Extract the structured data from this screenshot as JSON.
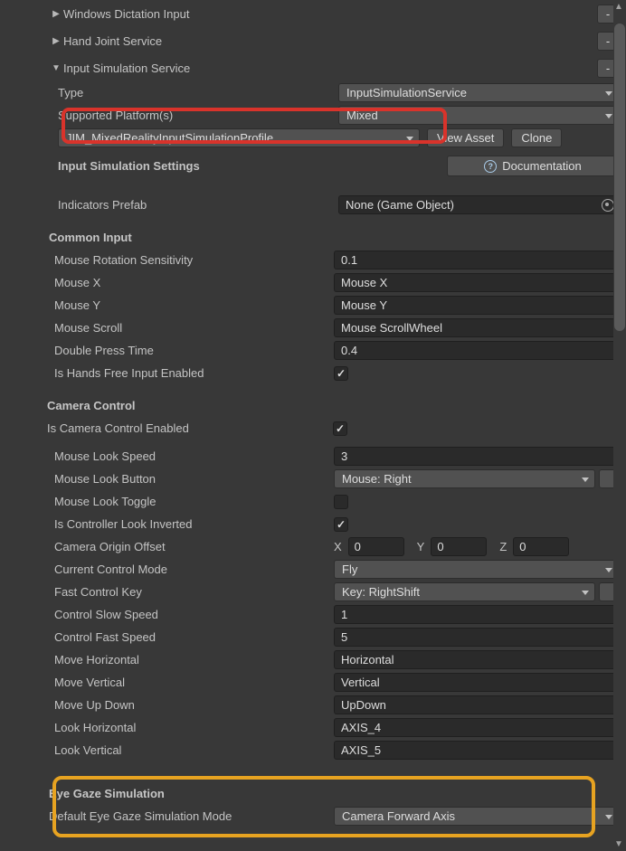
{
  "sections": [
    {
      "title": "Windows Dictation Input",
      "minus": "-",
      "expanded": false
    },
    {
      "title": "Hand Joint Service",
      "minus": "-",
      "expanded": false
    },
    {
      "title": "Input Simulation Service",
      "minus": "-",
      "expanded": true
    }
  ],
  "type_row": {
    "label": "Type",
    "value": "InputSimulationService"
  },
  "platforms_row": {
    "label": "Supported Platform(s)",
    "value": "Mixed"
  },
  "profile_row": {
    "value": "JIM_MixedRealityInputSimulationProfile",
    "view": "View Asset",
    "clone": "Clone"
  },
  "settings_header": "Input Simulation Settings",
  "doc_button": "Documentation",
  "indicators": {
    "label": "Indicators Prefab",
    "value": "None (Game Object)"
  },
  "common_input": {
    "header": "Common Input",
    "rows": [
      {
        "kind": "num",
        "label": "Mouse Rotation Sensitivity",
        "value": "0.1"
      },
      {
        "kind": "text",
        "label": "Mouse X",
        "value": "Mouse X"
      },
      {
        "kind": "text",
        "label": "Mouse Y",
        "value": "Mouse Y"
      },
      {
        "kind": "text",
        "label": "Mouse Scroll",
        "value": "Mouse ScrollWheel"
      },
      {
        "kind": "num",
        "label": "Double Press Time",
        "value": "0.4"
      },
      {
        "kind": "check",
        "label": "Is Hands Free Input Enabled",
        "checked": true
      }
    ]
  },
  "camera_control": {
    "header": "Camera Control",
    "enabled": {
      "label": "Is Camera Control Enabled",
      "checked": true
    },
    "rows": [
      {
        "kind": "num",
        "label": "Mouse Look Speed",
        "value": "3"
      },
      {
        "kind": "dd_x",
        "label": "Mouse Look Button",
        "value": "Mouse: Right"
      },
      {
        "kind": "check",
        "label": "Mouse Look Toggle",
        "checked": false
      },
      {
        "kind": "check",
        "label": "Is Controller Look Inverted",
        "checked": true
      },
      {
        "kind": "vec3",
        "label": "Camera Origin Offset",
        "x": "0",
        "y": "0",
        "z": "0"
      },
      {
        "kind": "dd",
        "label": "Current Control Mode",
        "value": "Fly"
      },
      {
        "kind": "dd_x",
        "label": "Fast Control Key",
        "value": "Key: RightShift"
      },
      {
        "kind": "num",
        "label": "Control Slow Speed",
        "value": "1"
      },
      {
        "kind": "num",
        "label": "Control Fast Speed",
        "value": "5"
      },
      {
        "kind": "text",
        "label": "Move Horizontal",
        "value": "Horizontal"
      },
      {
        "kind": "text",
        "label": "Move Vertical",
        "value": "Vertical"
      },
      {
        "kind": "text",
        "label": "Move Up Down",
        "value": "UpDown"
      },
      {
        "kind": "text",
        "label": "Look Horizontal",
        "value": "AXIS_4"
      },
      {
        "kind": "text",
        "label": "Look Vertical",
        "value": "AXIS_5"
      }
    ]
  },
  "eye_gaze": {
    "header": "Eye Gaze Simulation",
    "row": {
      "label": "Default Eye Gaze Simulation Mode",
      "value": "Camera Forward Axis"
    }
  },
  "colors": {
    "highlight_red": "#d9332b",
    "highlight_amber": "#e7a321"
  }
}
